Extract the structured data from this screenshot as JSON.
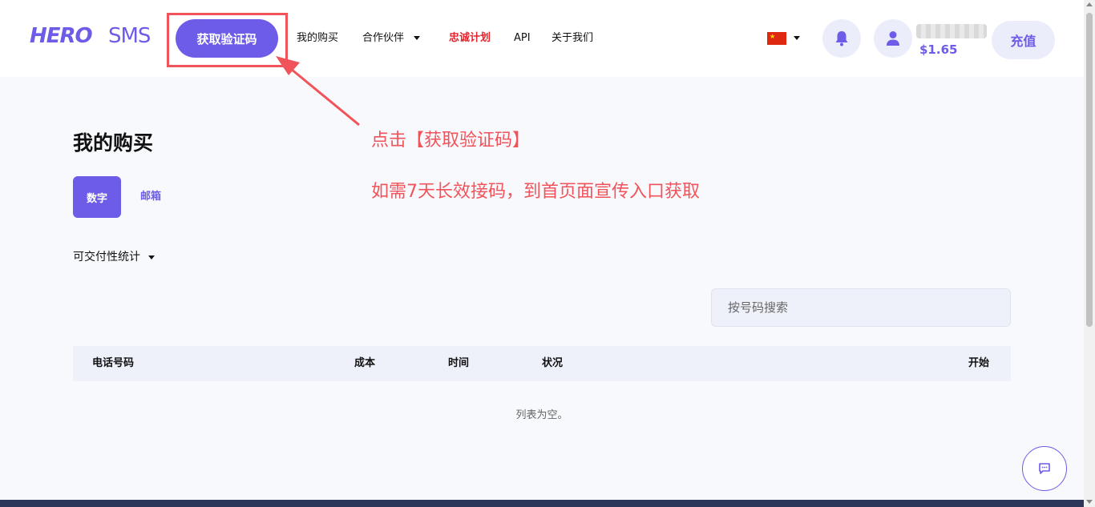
{
  "header": {
    "logo": {
      "part1": "HERO",
      "part2": "SMS"
    },
    "get_code_button": "获取验证码",
    "nav": {
      "my_purchases": "我的购买",
      "partners": "合作伙伴",
      "loyalty": "忠诚计划",
      "api": "API",
      "about": "关于我们"
    },
    "language_flag": "flag-cn-icon",
    "balance": "$1.65",
    "recharge_button": "充值"
  },
  "annotation": {
    "line1": "点击【获取验证码】",
    "line2": "如需7天长效接码，到首页面宣传入口获取",
    "highlight_color": "#f0545a"
  },
  "main": {
    "title": "我的购买",
    "tabs": [
      {
        "label": "数字",
        "active": true
      },
      {
        "label": "邮箱",
        "active": false
      }
    ],
    "stats_toggle": "可交付性统计",
    "search_placeholder": "按号码搜索",
    "table": {
      "columns": [
        "电话号码",
        "成本",
        "时间",
        "状况",
        "开始"
      ],
      "empty_text": "列表为空。"
    }
  },
  "colors": {
    "accent": "#6c5ce7",
    "loyalty": "#e0262f",
    "footer": "#2c3659"
  }
}
